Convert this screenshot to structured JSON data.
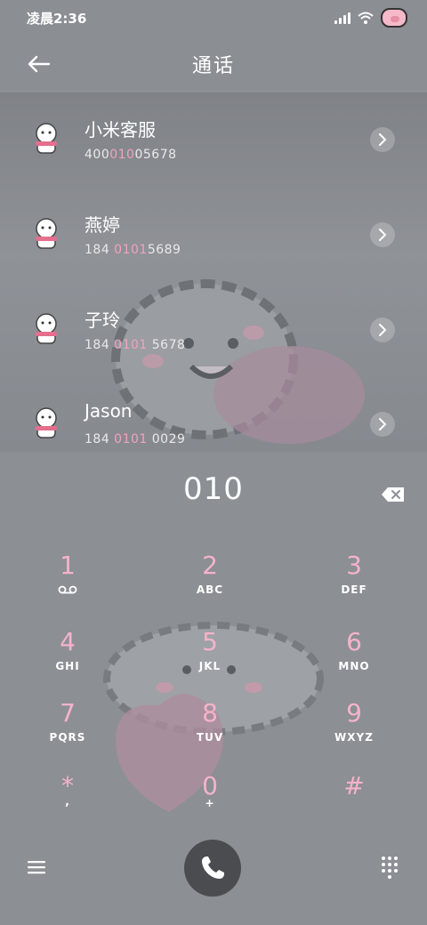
{
  "status_bar": {
    "time": "凌晨2:36"
  },
  "header": {
    "title": "通话"
  },
  "contacts": [
    {
      "name": "小米客服",
      "number_parts": [
        "400",
        "010",
        "05678"
      ]
    },
    {
      "name": "燕婷",
      "number_parts": [
        "184 ",
        "0101",
        "5689"
      ]
    },
    {
      "name": "子玲",
      "number_parts": [
        "184 ",
        "0101",
        " 5678"
      ]
    },
    {
      "name": "Jason",
      "number_parts": [
        "184 ",
        "0101",
        " 0029"
      ]
    }
  ],
  "dialer": {
    "input": "010",
    "keys": [
      {
        "digit": "1",
        "letters": ""
      },
      {
        "digit": "2",
        "letters": "ABC"
      },
      {
        "digit": "3",
        "letters": "DEF"
      },
      {
        "digit": "4",
        "letters": "GHI"
      },
      {
        "digit": "5",
        "letters": "JKL"
      },
      {
        "digit": "6",
        "letters": "MNO"
      },
      {
        "digit": "7",
        "letters": "PQRS"
      },
      {
        "digit": "8",
        "letters": "TUV"
      },
      {
        "digit": "9",
        "letters": "WXYZ"
      },
      {
        "digit": "*",
        "letters": ","
      },
      {
        "digit": "0",
        "letters": "+"
      },
      {
        "digit": "#",
        "letters": ""
      }
    ]
  },
  "colors": {
    "accent_pink": "#f0a3bd",
    "background": "#8c8f94"
  },
  "icons": [
    "back-arrow-icon",
    "chevron-right-icon",
    "backspace-icon",
    "voicemail-icon",
    "menu-icon",
    "phone-icon",
    "dialpad-icon"
  ]
}
